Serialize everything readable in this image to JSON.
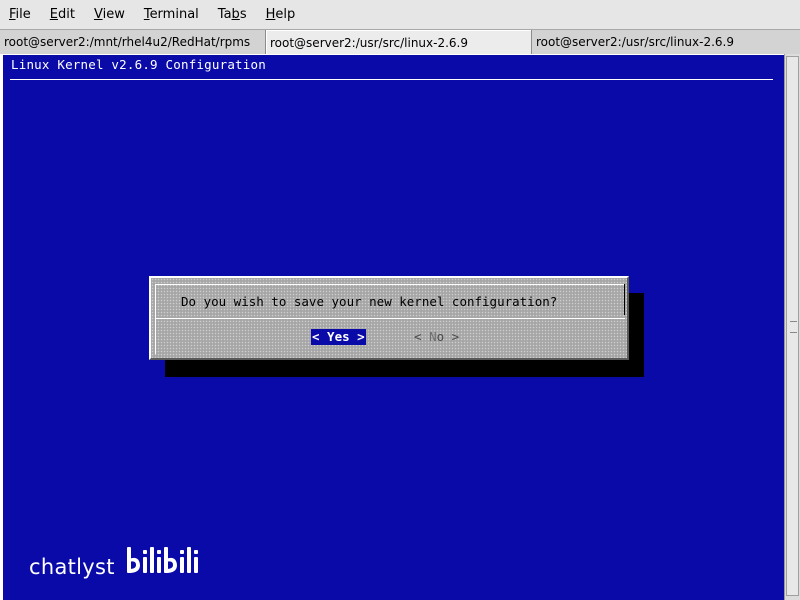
{
  "menubar": {
    "items": [
      {
        "pre": "",
        "accel": "F",
        "post": "ile"
      },
      {
        "pre": "",
        "accel": "E",
        "post": "dit"
      },
      {
        "pre": "",
        "accel": "V",
        "post": "iew"
      },
      {
        "pre": "",
        "accel": "T",
        "post": "erminal"
      },
      {
        "pre": "Ta",
        "accel": "b",
        "post": "s"
      },
      {
        "pre": "",
        "accel": "H",
        "post": "elp"
      }
    ]
  },
  "tabs": [
    {
      "label": "root@server2:/mnt/rhel4u2/RedHat/rpms",
      "active": false
    },
    {
      "label": "root@server2:/usr/src/linux-2.6.9",
      "active": true
    },
    {
      "label": "root@server2:/usr/src/linux-2.6.9",
      "active": false
    }
  ],
  "terminal": {
    "backtitle": "Linux Kernel v2.6.9 Configuration",
    "background_color": "#0a0aa8"
  },
  "dialog": {
    "message": "Do you wish to save your new kernel configuration?",
    "yes_label": "< Yes >",
    "no": {
      "open": "<  ",
      "letter": "N",
      "rest": "o  >"
    }
  },
  "watermark": {
    "text": "chatlyst",
    "logo": "bilibili"
  }
}
